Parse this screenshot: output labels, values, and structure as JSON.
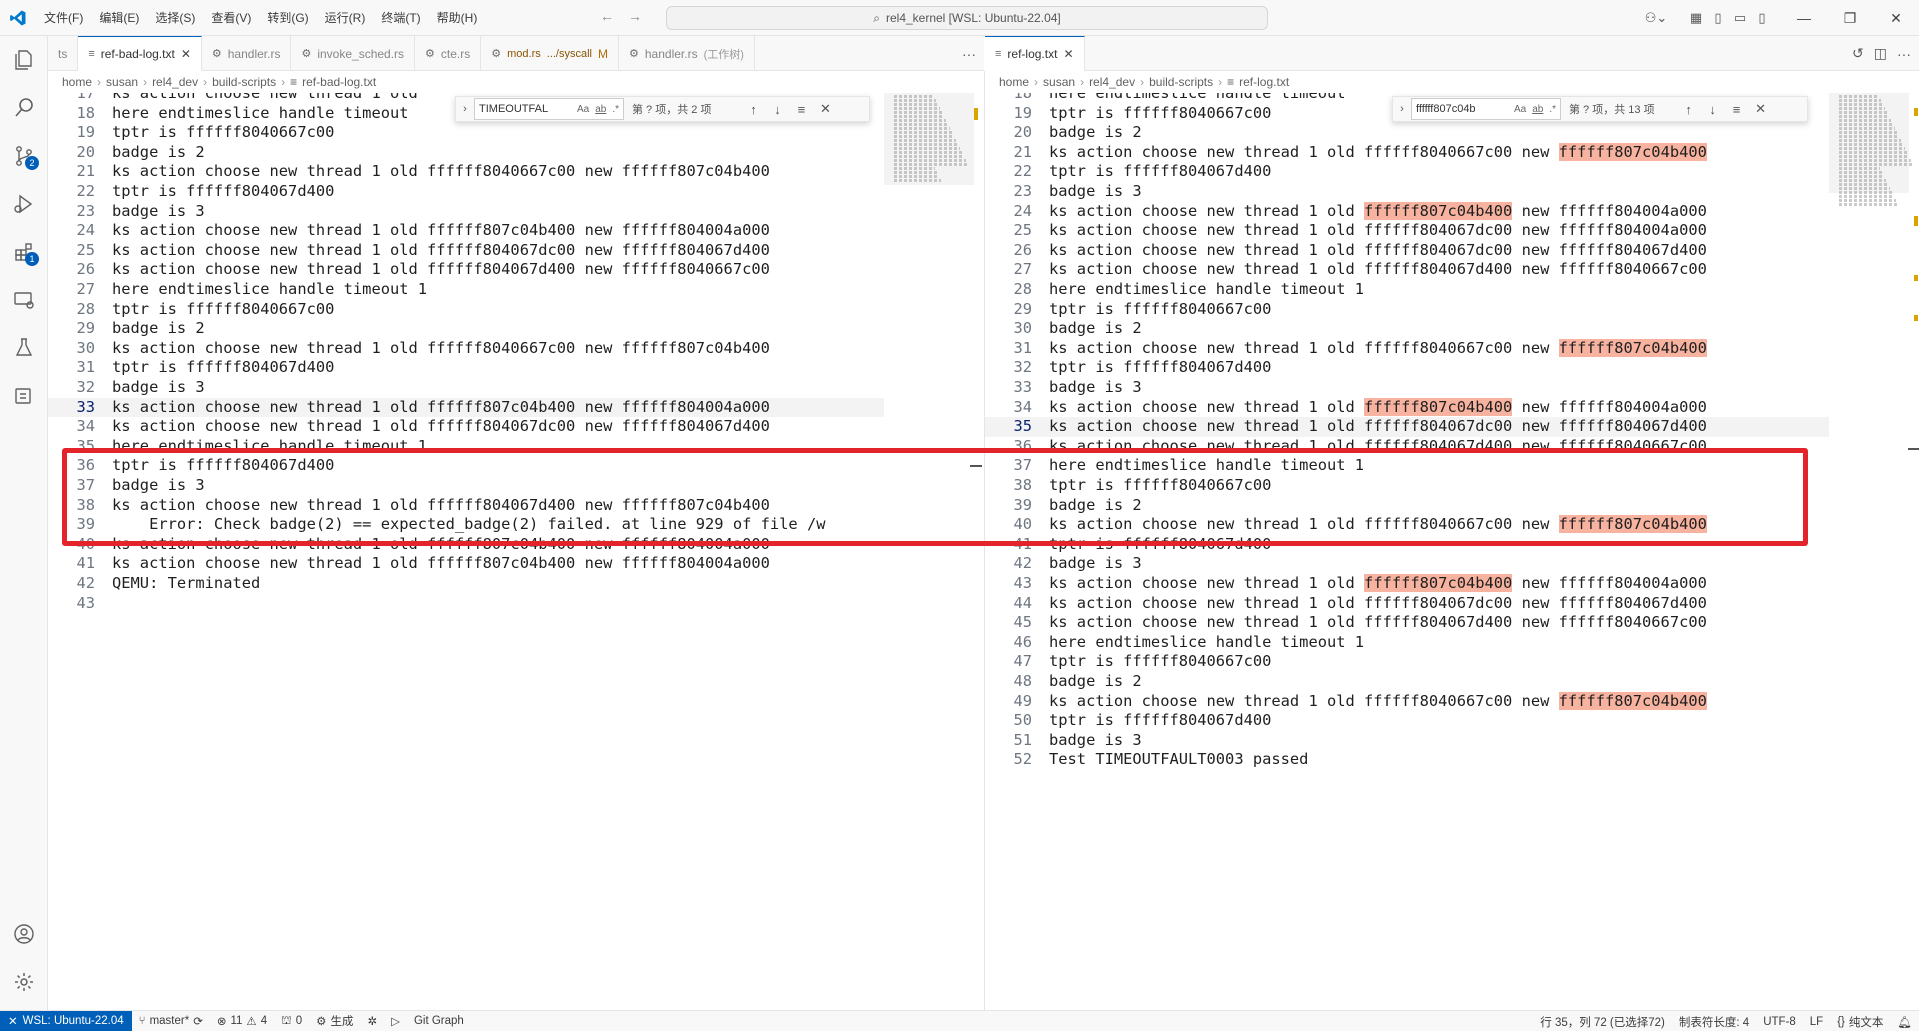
{
  "titlebar": {
    "menus": [
      "文件(F)",
      "编辑(E)",
      "选择(S)",
      "查看(V)",
      "转到(G)",
      "运行(R)",
      "终端(T)",
      "帮助(H)"
    ],
    "command_center": "rel4_kernel [WSL: Ubuntu-22.04]"
  },
  "left": {
    "tabs": [
      {
        "label": "ts",
        "desc": "",
        "active": false
      },
      {
        "label": "ref-bad-log.txt",
        "desc": "",
        "active": true
      },
      {
        "label": "handler.rs",
        "desc": "",
        "active": false
      },
      {
        "label": "invoke_sched.rs",
        "desc": "",
        "active": false
      },
      {
        "label": "cte.rs",
        "desc": "",
        "active": false
      },
      {
        "label": "mod.rs",
        "desc": ".../syscall",
        "mod": "M",
        "active": false
      },
      {
        "label": "handler.rs",
        "desc": "(工作树)",
        "active": false
      }
    ],
    "breadcrumbs": [
      "home",
      "susan",
      "rel4_dev",
      "build-scripts",
      "ref-bad-log.txt"
    ],
    "find": {
      "value": "TIMEOUTFAL",
      "opt_case": "Aa",
      "opt_word": "ab",
      "opt_regex": ".*",
      "count": "第 ? 项，共 2 项"
    },
    "lines": [
      {
        "n": "17",
        "t": "ks action choose new thread 1 old"
      },
      {
        "n": "18",
        "t": "here endtimeslice handle timeout"
      },
      {
        "n": "19",
        "t": "tptr is ffffff8040667c00"
      },
      {
        "n": "20",
        "t": "badge is 2"
      },
      {
        "n": "21",
        "t": "ks action choose new thread 1 old ffffff8040667c00 new ffffff807c04b400"
      },
      {
        "n": "22",
        "t": "tptr is ffffff804067d400"
      },
      {
        "n": "23",
        "t": "badge is 3"
      },
      {
        "n": "24",
        "t": "ks action choose new thread 1 old ffffff807c04b400 new ffffff804004a000"
      },
      {
        "n": "25",
        "t": "ks action choose new thread 1 old ffffff804067dc00 new ffffff804067d400"
      },
      {
        "n": "26",
        "t": "ks action choose new thread 1 old ffffff804067d400 new ffffff8040667c00"
      },
      {
        "n": "27",
        "t": "here endtimeslice handle timeout 1"
      },
      {
        "n": "28",
        "t": "tptr is ffffff8040667c00"
      },
      {
        "n": "29",
        "t": "badge is 2"
      },
      {
        "n": "30",
        "t": "ks action choose new thread 1 old ffffff8040667c00 new ffffff807c04b400"
      },
      {
        "n": "31",
        "t": "tptr is ffffff804067d400"
      },
      {
        "n": "32",
        "t": "badge is 3"
      },
      {
        "n": "33",
        "t": "ks action choose new thread 1 old ffffff807c04b400 new ffffff804004a000"
      },
      {
        "n": "34",
        "t": "ks action choose new thread 1 old ffffff804067dc00 new ffffff804067d400"
      },
      {
        "n": "35",
        "t": "here endtimeslice handle timeout 1"
      },
      {
        "n": "36",
        "t": "tptr is ffffff804067d400"
      },
      {
        "n": "37",
        "t": "badge is 3"
      },
      {
        "n": "38",
        "t": "ks action choose new thread 1 old ffffff804067d400 new ffffff807c04b400"
      },
      {
        "n": "39",
        "t": "    Error: Check badge(2) == expected_badge(2) failed. at line 929 of file /w"
      },
      {
        "n": "40",
        "t": "ks action choose new thread 1 old ffffff807c04b400 new ffffff804004a000"
      },
      {
        "n": "41",
        "t": "ks action choose new thread 1 old ffffff807c04b400 new ffffff804004a000"
      },
      {
        "n": "42",
        "t": "QEMU: Terminated"
      },
      {
        "n": "43",
        "t": ""
      }
    ]
  },
  "right": {
    "tabs": [
      {
        "label": "ref-log.txt",
        "desc": "",
        "active": true
      }
    ],
    "breadcrumbs": [
      "home",
      "susan",
      "rel4_dev",
      "build-scripts",
      "ref-log.txt"
    ],
    "find": {
      "value": "ffffff807c04b",
      "opt_case": "Aa",
      "opt_word": "ab",
      "opt_regex": ".*",
      "count": "第 ? 项，共 13 项"
    },
    "highlight": "ffffff807c04b400",
    "lines": [
      {
        "n": "18",
        "t": "here endtimeslice handle timeout"
      },
      {
        "n": "19",
        "t": "tptr is ffffff8040667c00"
      },
      {
        "n": "20",
        "t": "badge is 2"
      },
      {
        "n": "21",
        "t": "ks action choose new thread 1 old ffffff8040667c00 new ffffff807c04b400"
      },
      {
        "n": "22",
        "t": "tptr is ffffff804067d400"
      },
      {
        "n": "23",
        "t": "badge is 3"
      },
      {
        "n": "24",
        "t": "ks action choose new thread 1 old ffffff807c04b400 new ffffff804004a000"
      },
      {
        "n": "25",
        "t": "ks action choose new thread 1 old ffffff804067dc00 new ffffff804004a000"
      },
      {
        "n": "26",
        "t": "ks action choose new thread 1 old ffffff804067dc00 new ffffff804067d400"
      },
      {
        "n": "27",
        "t": "ks action choose new thread 1 old ffffff804067d400 new ffffff8040667c00"
      },
      {
        "n": "28",
        "t": "here endtimeslice handle timeout 1"
      },
      {
        "n": "29",
        "t": "tptr is ffffff8040667c00"
      },
      {
        "n": "30",
        "t": "badge is 2"
      },
      {
        "n": "31",
        "t": "ks action choose new thread 1 old ffffff8040667c00 new ffffff807c04b400"
      },
      {
        "n": "32",
        "t": "tptr is ffffff804067d400"
      },
      {
        "n": "33",
        "t": "badge is 3"
      },
      {
        "n": "34",
        "t": "ks action choose new thread 1 old ffffff807c04b400 new ffffff804004a000"
      },
      {
        "n": "35",
        "t": "ks action choose new thread 1 old ffffff804067dc00 new ffffff804067d400"
      },
      {
        "n": "36",
        "t": "ks action choose new thread 1 old ffffff804067d400 new ffffff8040667c00"
      },
      {
        "n": "37",
        "t": "here endtimeslice handle timeout 1"
      },
      {
        "n": "38",
        "t": "tptr is ffffff8040667c00"
      },
      {
        "n": "39",
        "t": "badge is 2"
      },
      {
        "n": "40",
        "t": "ks action choose new thread 1 old ffffff8040667c00 new ffffff807c04b400"
      },
      {
        "n": "41",
        "t": "tptr is ffffff804067d400"
      },
      {
        "n": "42",
        "t": "badge is 3"
      },
      {
        "n": "43",
        "t": "ks action choose new thread 1 old ffffff807c04b400 new ffffff804004a000"
      },
      {
        "n": "44",
        "t": "ks action choose new thread 1 old ffffff804067dc00 new ffffff804067d400"
      },
      {
        "n": "45",
        "t": "ks action choose new thread 1 old ffffff804067d400 new ffffff8040667c00"
      },
      {
        "n": "46",
        "t": "here endtimeslice handle timeout 1"
      },
      {
        "n": "47",
        "t": "tptr is ffffff8040667c00"
      },
      {
        "n": "48",
        "t": "badge is 2"
      },
      {
        "n": "49",
        "t": "ks action choose new thread 1 old ffffff8040667c00 new ffffff807c04b400"
      },
      {
        "n": "50",
        "t": "tptr is ffffff804067d400"
      },
      {
        "n": "51",
        "t": "badge is 3"
      },
      {
        "n": "52",
        "t": "Test TIMEOUTFAULT0003 passed"
      }
    ]
  },
  "statusbar": {
    "remote": "WSL: Ubuntu-22.04",
    "branch": "master*",
    "errors": "11",
    "warnings": "4",
    "ports": "0",
    "build": "生成",
    "gitgraph": "Git Graph",
    "position": "行 35，列 72 (已选择72)",
    "tabsize": "制表符长度: 4",
    "encoding": "UTF-8",
    "eol": "LF",
    "language": "纯文本"
  },
  "colors": {
    "accent": "#005fb8",
    "annotation": "#e4242b",
    "match": "#f7b3a0"
  }
}
